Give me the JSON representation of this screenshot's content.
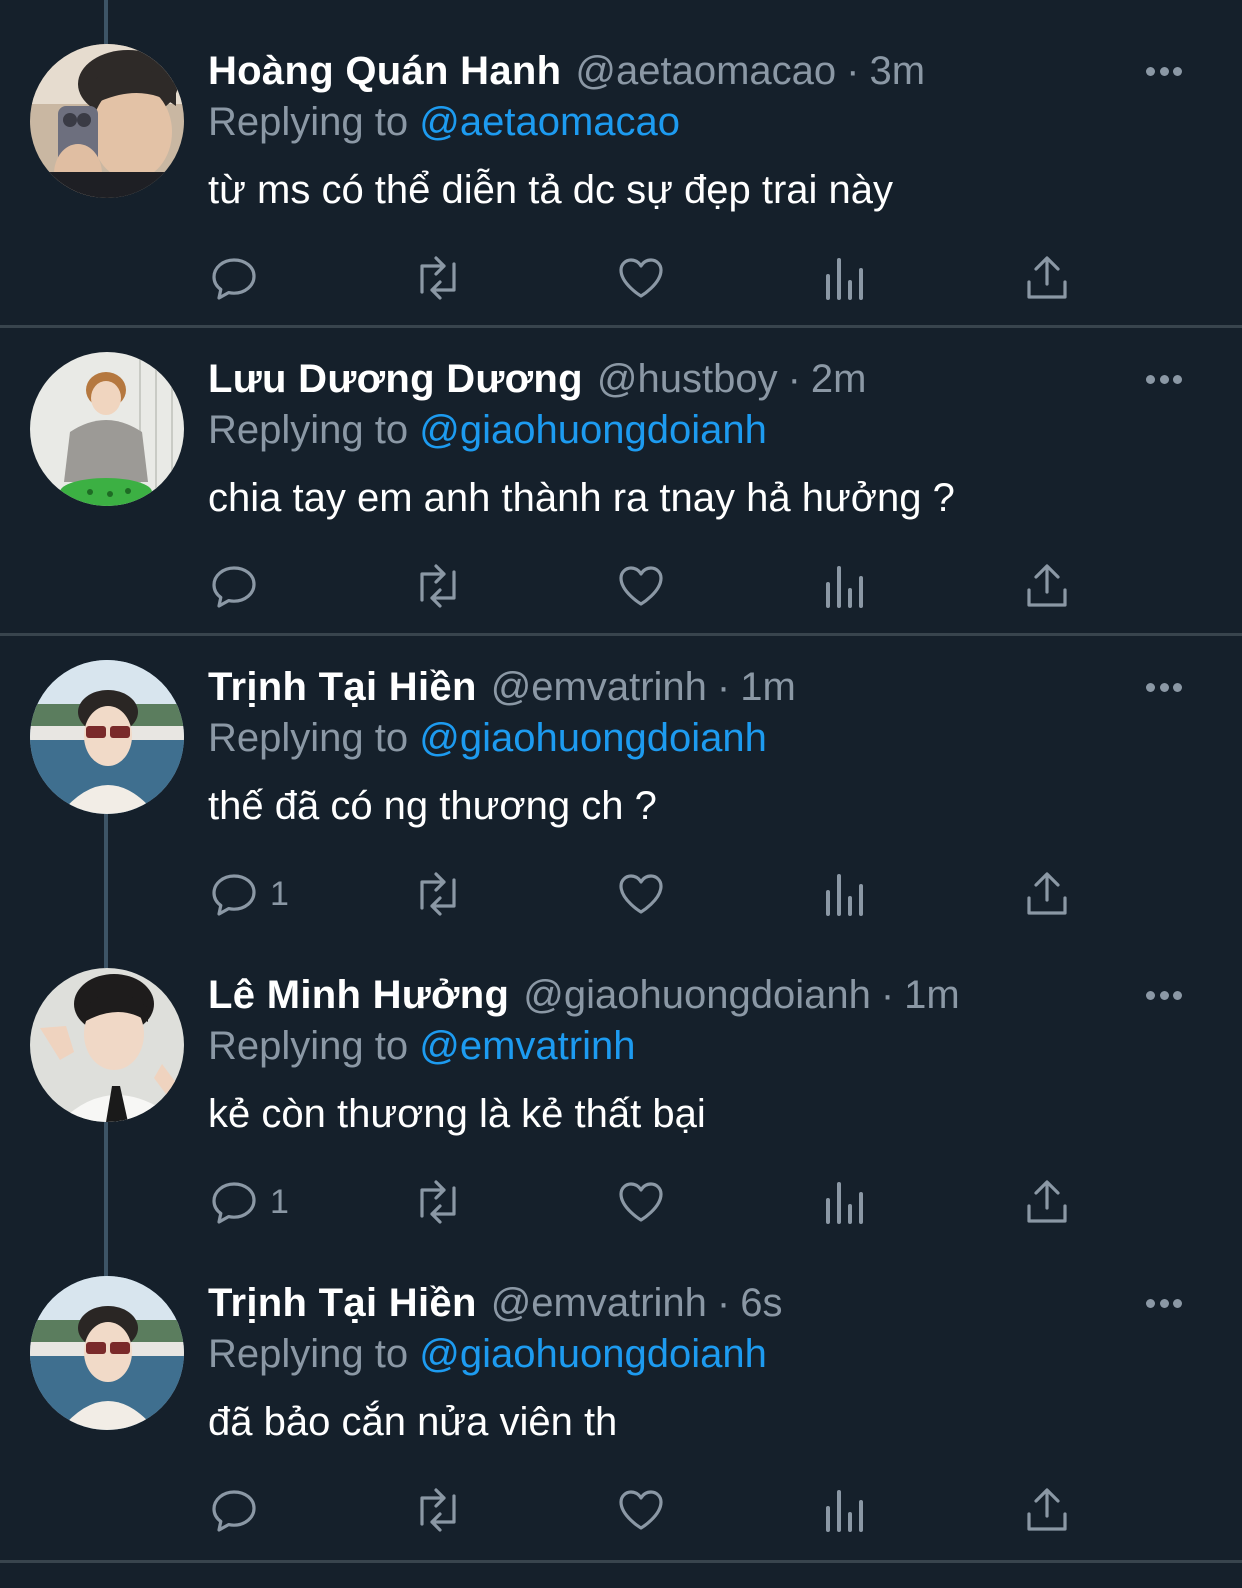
{
  "tweets": [
    {
      "name": "Hoàng Quán Hanh",
      "handle": "@aetaomacao",
      "separator": "·",
      "time": "3m",
      "replying_prefix": "Replying to",
      "replying_to": "@aetaomacao",
      "text": "từ ms có thể diễn tả dc sự đẹp trai này",
      "reply_count": "",
      "avatar": "person-selfie-phone"
    },
    {
      "name": "Lưu Dương Dương",
      "handle": "@hustboy",
      "separator": "·",
      "time": "2m",
      "replying_prefix": "Replying to",
      "replying_to": "@giaohuongdoianh",
      "text": "chia tay em anh thành ra tnay hả hưởng ?",
      "reply_count": "",
      "avatar": "person-grey-sweater"
    },
    {
      "name": "Trịnh Tại Hiền",
      "handle": "@emvatrinh",
      "separator": "·",
      "time": "1m",
      "replying_prefix": "Replying to",
      "replying_to": "@giaohuongdoianh",
      "text": "thế đã có ng thương ch ?",
      "reply_count": "1",
      "avatar": "person-sunglasses-sea"
    },
    {
      "name": "Lê Minh Hưởng",
      "handle": "@giaohuongdoianh",
      "separator": "·",
      "time": "1m",
      "replying_prefix": "Replying to",
      "replying_to": "@emvatrinh",
      "text": "kẻ còn thương là kẻ thất bại",
      "reply_count": "1",
      "avatar": "person-peace-sign"
    },
    {
      "name": "Trịnh Tại Hiền",
      "handle": "@emvatrinh",
      "separator": "·",
      "time": "6s",
      "replying_prefix": "Replying to",
      "replying_to": "@giaohuongdoianh",
      "text": "đã bảo cắn nửa viên th",
      "reply_count": "",
      "avatar": "person-sunglasses-sea"
    }
  ],
  "actions": [
    "reply-icon",
    "retweet-icon",
    "like-icon",
    "views-icon",
    "share-icon"
  ],
  "colors": {
    "background": "#15202b",
    "name": "#ffffff",
    "secondary": "#8b98a5",
    "mention": "#1d9bf0",
    "divider": "#38444d",
    "thread_line": "#3d5466"
  }
}
